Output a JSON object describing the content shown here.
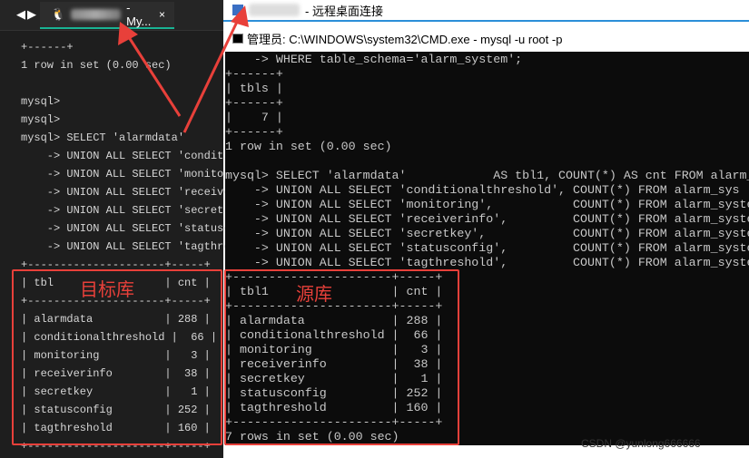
{
  "left_window": {
    "tab": {
      "title_suffix": "-My...",
      "close": "×"
    },
    "nav": {
      "back": "◀",
      "forward": "▶"
    },
    "lines": [
      "+------+",
      "1 row in set (0.00 sec)",
      "",
      "mysql>",
      "mysql>",
      "mysql> SELECT 'alarmdata'",
      "    -> UNION ALL SELECT 'conditi",
      "    -> UNION ALL SELECT 'monitor",
      "    -> UNION ALL SELECT 'receive",
      "    -> UNION ALL SELECT 'secretk",
      "    -> UNION ALL SELECT 'statusc",
      "    -> UNION ALL SELECT 'tagthre",
      "+---------------------+-----+",
      "| tbl                 | cnt |",
      "+---------------------+-----+",
      "| alarmdata           | 288 |",
      "| conditionalthreshold |  66 |",
      "| monitoring          |   3 |",
      "| receiverinfo        |  38 |",
      "| secretkey           |   1 |",
      "| statusconfig        | 252 |",
      "| tagthreshold        | 160 |",
      "+---------------------+-----+"
    ],
    "annotation": "目标库"
  },
  "right_window": {
    "remote_title": "- 远程桌面连接",
    "cmd_title": "管理员: C:\\WINDOWS\\system32\\CMD.exe - mysql  -u root -p",
    "lines": [
      "    -> WHERE table_schema='alarm_system';",
      "+------+",
      "| tbls |",
      "+------+",
      "|    7 |",
      "+------+",
      "1 row in set (0.00 sec)",
      "",
      "mysql> SELECT 'alarmdata'            AS tbl1, COUNT(*) AS cnt FROM alarm_",
      "    -> UNION ALL SELECT 'conditionalthreshold', COUNT(*) FROM alarm_sys",
      "    -> UNION ALL SELECT 'monitoring',           COUNT(*) FROM alarm_syste",
      "    -> UNION ALL SELECT 'receiverinfo',         COUNT(*) FROM alarm_syste",
      "    -> UNION ALL SELECT 'secretkey',            COUNT(*) FROM alarm_syste",
      "    -> UNION ALL SELECT 'statusconfig',         COUNT(*) FROM alarm_syste",
      "    -> UNION ALL SELECT 'tagthreshold',         COUNT(*) FROM alarm_syste",
      "+----------------------+-----+",
      "| tbl1                 | cnt |",
      "+----------------------+-----+",
      "| alarmdata            | 288 |",
      "| conditionalthreshold |  66 |",
      "| monitoring           |   3 |",
      "| receiverinfo         |  38 |",
      "| secretkey            |   1 |",
      "| statusconfig         | 252 |",
      "| tagthreshold         | 160 |",
      "+----------------------+-----+",
      "7 rows in set (0.00 sec)"
    ],
    "annotation": "源库"
  },
  "footer": "CSDN @yunlong666666",
  "colors": {
    "annotation": "#e8403a",
    "tab_accent": "#19b394"
  }
}
